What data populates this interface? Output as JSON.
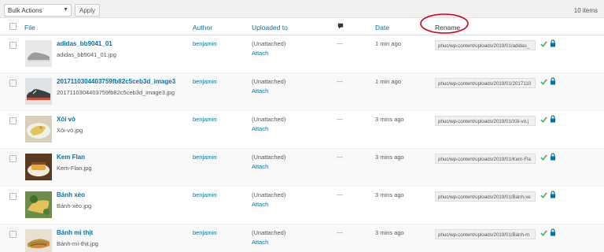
{
  "toolbar": {
    "bulk_actions": "Bulk Actions",
    "apply": "Apply",
    "items_count": "10 items"
  },
  "columns": {
    "file": "File",
    "author": "Author",
    "uploaded_to": "Uploaded to",
    "date": "Date",
    "rename": "Rename"
  },
  "colors": {
    "link": "#0073aa",
    "check": "#46b450",
    "lock": "#0073aa",
    "annotation": "#d0021b"
  },
  "rows": [
    {
      "title": "adidas_bb9041_01",
      "filename": "adidas_bb9041_01.jpg",
      "author": "benjamin",
      "uploaded_to": "(Unattached)",
      "attach": "Attach",
      "comments": "—",
      "date": "1 min ago",
      "rename_value": "phuc/wp-content/uploads/2019/01/adidas_",
      "thumb": "shoe-gray"
    },
    {
      "title": "20171103044037 59fb82c5ceb3d_image3",
      "filename": "2017110304403759fb82c5ceb3d_image3.jpg",
      "author": "benjamin",
      "uploaded_to": "(Unattached)",
      "attach": "Attach",
      "comments": "—",
      "date": "1 min ago",
      "rename_value": "phuc/wp-content/uploads/2019/01/2017110",
      "thumb": "shoe-dark"
    },
    {
      "title": "Xôi vò",
      "filename": "Xôi-vò.jpg",
      "author": "benjamin",
      "uploaded_to": "(Unattached)",
      "attach": "Attach",
      "comments": "—",
      "date": "3 mins ago",
      "rename_value": "phuc/wp-content/uploads/2019/01/Xôi-vò.j",
      "thumb": "food-yellow"
    },
    {
      "title": "Kem Flan",
      "filename": "Kem-Flan.jpg",
      "author": "benjamin",
      "uploaded_to": "(Unattached)",
      "attach": "Attach",
      "comments": "—",
      "date": "3 mins ago",
      "rename_value": "phuc/wp-content/uploads/2019/01/Kem-Fla",
      "thumb": "food-flan"
    },
    {
      "title": "Bánh xèo",
      "filename": "Bánh-xèo.jpg",
      "author": "benjamin",
      "uploaded_to": "(Unattached)",
      "attach": "Attach",
      "comments": "—",
      "date": "3 mins ago",
      "rename_value": "phuc/wp-content/uploads/2019/01/Bánh-xe",
      "thumb": "food-green"
    },
    {
      "title": "Bánh mì thịt",
      "filename": "Bánh-mì-thịt.jpg",
      "author": "benjamin",
      "uploaded_to": "(Unattached)",
      "attach": "Attach",
      "comments": "—",
      "date": "3 mins ago",
      "rename_value": "phuc/wp-content/uploads/2019/01/Bánh-m",
      "thumb": "food-bread"
    }
  ]
}
